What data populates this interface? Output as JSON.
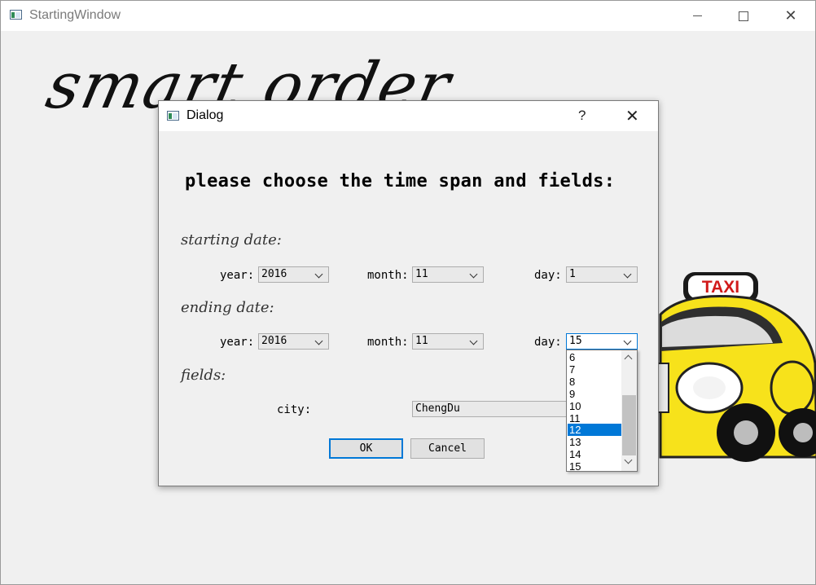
{
  "window": {
    "title": "StartingWindow",
    "background_text": "smart order"
  },
  "dialog": {
    "title": "Dialog",
    "help": "?",
    "heading": "please choose the time span and fields:",
    "starting_label": "starting date:",
    "ending_label": "ending date:",
    "fields_label": "fields:",
    "start": {
      "year_label": "year:",
      "year": "2016",
      "month_label": "month:",
      "month": "11",
      "day_label": "day:",
      "day": "1"
    },
    "end": {
      "year_label": "year:",
      "year": "2016",
      "month_label": "month:",
      "month": "11",
      "day_label": "day:",
      "day": "15"
    },
    "city_label": "city:",
    "city": "ChengDu",
    "ok": "OK",
    "cancel": "Cancel"
  },
  "day_dropdown": {
    "items": [
      "6",
      "7",
      "8",
      "9",
      "10",
      "11",
      "12",
      "13",
      "14",
      "15"
    ],
    "highlighted": "12"
  },
  "taxi": {
    "sign": "TAXI"
  },
  "colors": {
    "accent": "#0078d7",
    "taxi_yellow": "#f7e21b"
  }
}
